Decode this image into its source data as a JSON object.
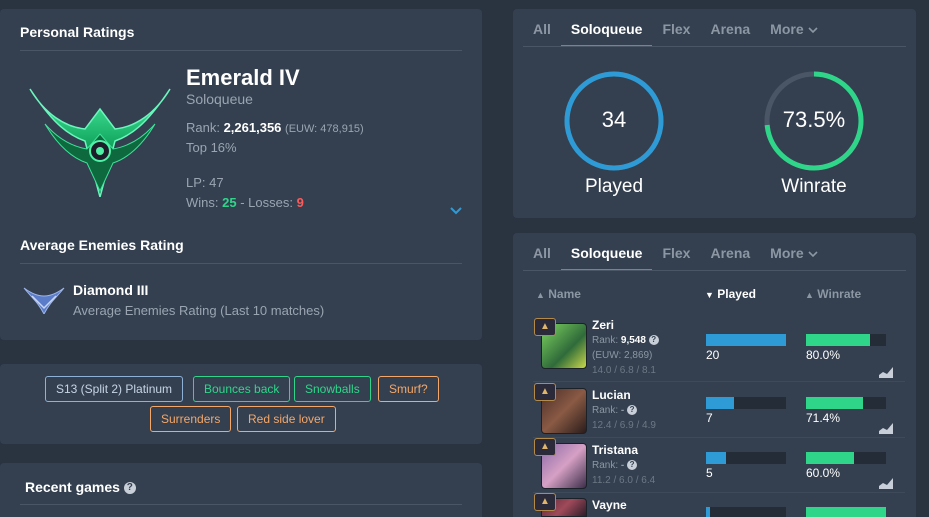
{
  "personal": {
    "title": "Personal Ratings",
    "rank_name": "Emerald IV",
    "queue": "Soloqueue",
    "rank_label": "Rank: ",
    "rank_value": "2,261,356",
    "rank_region": "(EUW: 478,915)",
    "top": "Top 16%",
    "lp": "LP: 47",
    "wins_label": "Wins: ",
    "wins": "25",
    "losses_sep": " - Losses: ",
    "losses": "9",
    "color_emerald": "#2fd68a",
    "color_loss": "#ff5a5a"
  },
  "enemies": {
    "title": "Average Enemies Rating",
    "rank_name": "Diamond III",
    "subtitle": "Average Enemies Rating (Last 10 matches)"
  },
  "tags": [
    {
      "label": "S13 (Split 2) Platinum",
      "style": "blue"
    },
    {
      "label": "Bounces back",
      "style": "green"
    },
    {
      "label": "Snowballs",
      "style": "green"
    },
    {
      "label": "Smurf?",
      "style": "orange"
    },
    {
      "label": "Surrenders",
      "style": "orange"
    },
    {
      "label": "Red side lover",
      "style": "orange"
    }
  ],
  "recent": {
    "title": "Recent games",
    "help_icon": "?"
  },
  "queue_tabs": [
    "All",
    "Soloqueue",
    "Flex",
    "Arena",
    "More"
  ],
  "stats": {
    "played": "34",
    "played_label": "Played",
    "played_fraction": 1,
    "winrate": "73.5%",
    "winrate_label": "Winrate",
    "winrate_fraction": 0.735,
    "played_color": "#2e9bd6",
    "winrate_color": "#2fd68a"
  },
  "table": {
    "headers": {
      "name": "Name",
      "played": "Played",
      "winrate": "Winrate"
    },
    "rows": [
      {
        "name": "Zeri",
        "rank_label": "Rank: ",
        "rank": "9,548",
        "region": "(EUW: 2,869)",
        "kda": "14.0 / 6.8 / 8.1",
        "played": "20",
        "played_frac": 1.0,
        "winrate": "80.0%",
        "winrate_frac": 0.8
      },
      {
        "name": "Lucian",
        "rank_label": "Rank: ",
        "rank": "-",
        "region": "",
        "kda": "12.4 / 6.9 / 4.9",
        "played": "7",
        "played_frac": 0.35,
        "winrate": "71.4%",
        "winrate_frac": 0.714
      },
      {
        "name": "Tristana",
        "rank_label": "Rank: ",
        "rank": "-",
        "region": "",
        "kda": "11.2 / 6.0 / 6.4",
        "played": "5",
        "played_frac": 0.25,
        "winrate": "60.0%",
        "winrate_frac": 0.6
      },
      {
        "name": "Vayne",
        "rank_label": "",
        "rank": "",
        "region": "",
        "kda": "",
        "played": "",
        "played_frac": 0.05,
        "winrate": "",
        "winrate_frac": 1.0
      }
    ]
  }
}
